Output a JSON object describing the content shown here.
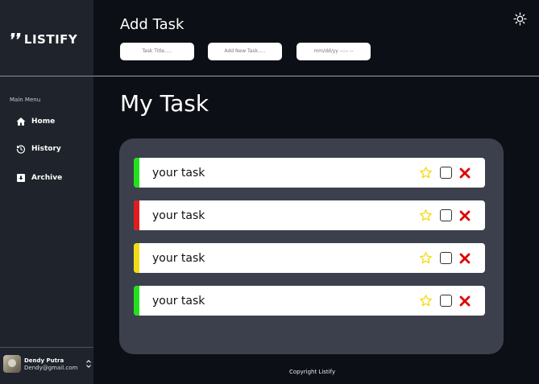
{
  "sidebar": {
    "logo": "LISTIFY",
    "menu_title": "Main Menu",
    "items": [
      {
        "label": "Home",
        "icon": "home-icon"
      },
      {
        "label": "History",
        "icon": "history-icon"
      },
      {
        "label": "Archive",
        "icon": "archive-icon"
      }
    ],
    "user": {
      "name": "Dendy Putra",
      "email": "Dendy@gmail.com"
    }
  },
  "header": {
    "title": "Add Task",
    "inputs": {
      "title_placeholder": "Task Title.....",
      "task_placeholder": "Add New Task.....",
      "date_placeholder": "mm/dd/yy --:-- --"
    },
    "theme_icon": "sun-icon"
  },
  "main": {
    "title": "My Task",
    "tasks": [
      {
        "text": "your task",
        "color": "#22e01b"
      },
      {
        "text": "your task",
        "color": "#e21b1b"
      },
      {
        "text": "your task",
        "color": "#f0dc17"
      },
      {
        "text": "your task",
        "color": "#22e01b"
      }
    ]
  },
  "footer": {
    "text": "Copyright Listify"
  },
  "colors": {
    "background": "#0c0f15",
    "sidebar": "#1f232b",
    "panel": "#3b404c",
    "star": "#f5d90a",
    "delete": "#e00000"
  }
}
